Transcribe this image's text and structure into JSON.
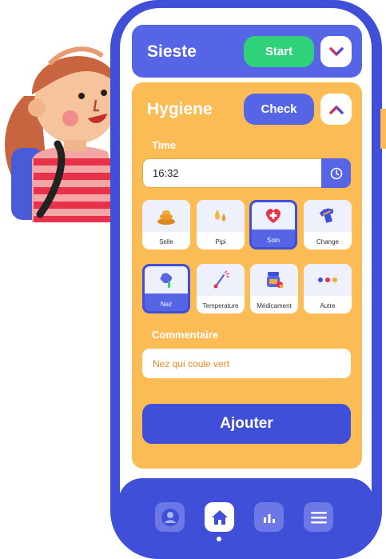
{
  "sieste": {
    "title": "Sieste",
    "start_label": "Start"
  },
  "hygiene": {
    "title": "Hygiene",
    "check_label": "Check",
    "time_label": "Time",
    "time_value": "16:32",
    "tiles_row1": [
      {
        "label": "Selle",
        "icon": "poop-icon",
        "selected": false
      },
      {
        "label": "Pipi",
        "icon": "drops-icon",
        "selected": false
      },
      {
        "label": "Soin",
        "icon": "heart-cross-icon",
        "selected": true
      },
      {
        "label": "Change",
        "icon": "shirt-icon",
        "selected": false
      }
    ],
    "tiles_row2": [
      {
        "label": "Nez",
        "icon": "nose-icon",
        "selected": true
      },
      {
        "label": "Temperature",
        "icon": "thermometer-icon",
        "selected": false
      },
      {
        "label": "Médicament",
        "icon": "medicine-jar-icon",
        "selected": false
      },
      {
        "label": "Autre",
        "icon": "dots-icon",
        "selected": false
      }
    ],
    "comment_label": "Commentaire",
    "comment_value": "Nez qui coule vert",
    "submit_label": "Ajouter"
  },
  "nav": [
    "profile-icon",
    "home-icon",
    "stats-icon",
    "menu-icon"
  ],
  "colors": {
    "primary": "#3f4fd8",
    "card": "#5664e6",
    "orange": "#fbbc56",
    "green": "#2fd17a",
    "red": "#e8324a"
  }
}
